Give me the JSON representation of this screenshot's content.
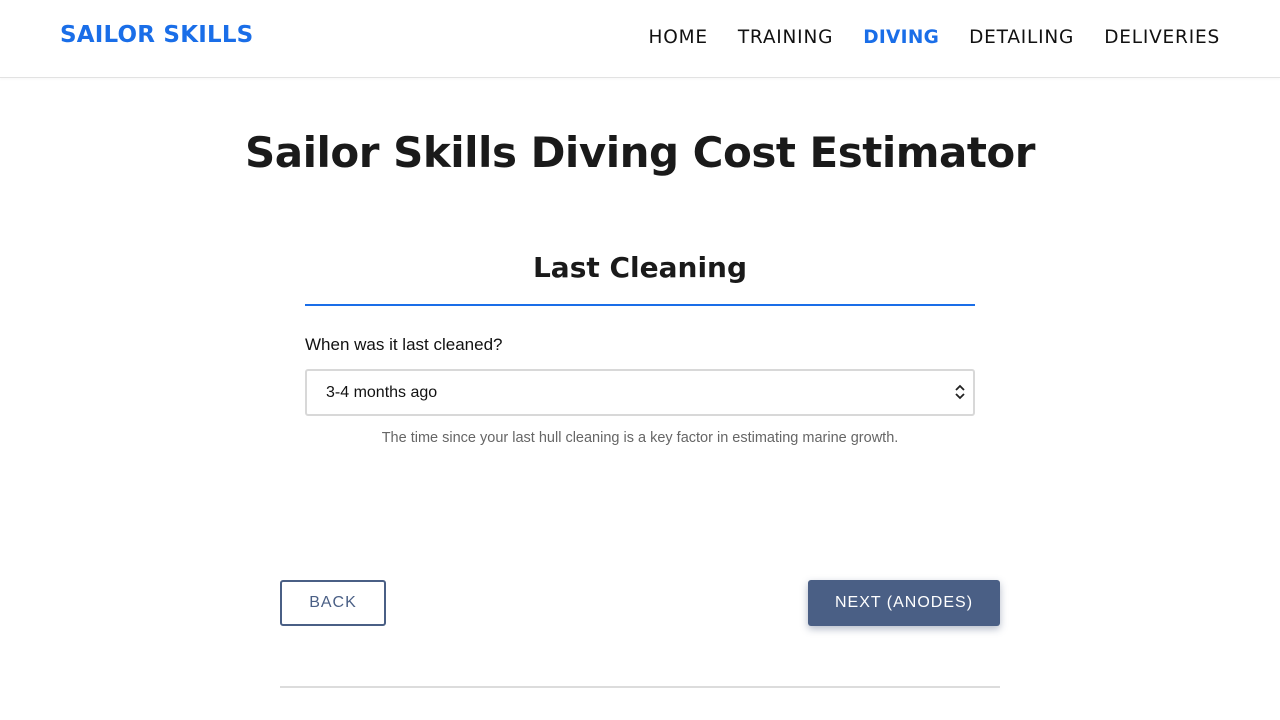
{
  "header": {
    "logo": "SAILOR SKILLS",
    "nav": [
      {
        "label": "HOME",
        "active": false
      },
      {
        "label": "TRAINING",
        "active": false
      },
      {
        "label": "DIVING",
        "active": true
      },
      {
        "label": "DETAILING",
        "active": false
      },
      {
        "label": "DELIVERIES",
        "active": false
      }
    ]
  },
  "main": {
    "title": "Sailor Skills Diving Cost Estimator",
    "section_title": "Last Cleaning",
    "field_label": "When was it last cleaned?",
    "select_value": "3-4 months ago",
    "help_text": "The time since your last hull cleaning is a key factor in estimating marine growth.",
    "back_label": "BACK",
    "next_label": "NEXT (ANODES)"
  },
  "colors": {
    "accent": "#1a6ee8",
    "button": "#4a5f85",
    "text": "#1a1a1a",
    "muted": "#666666"
  }
}
